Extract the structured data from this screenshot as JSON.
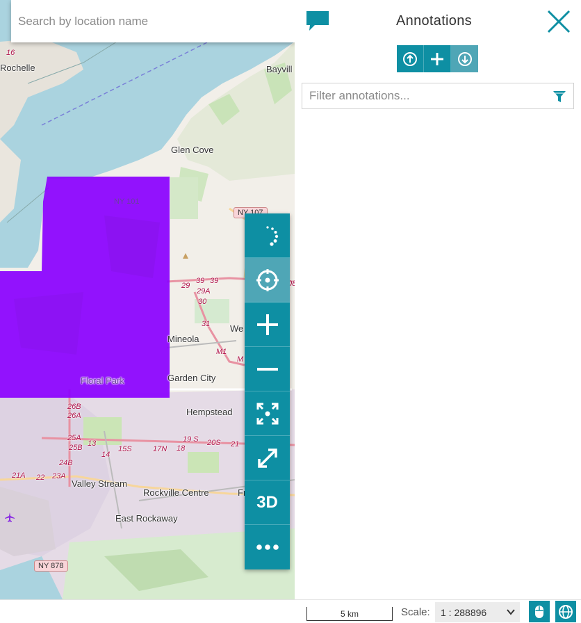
{
  "search": {
    "placeholder": "Search by location name"
  },
  "map": {
    "place_labels": [
      "Rochelle",
      "Bayvill",
      "Glen Cove",
      "Mineola",
      "Garden City",
      "Hempstead",
      "Valley Stream",
      "Rockville Centre",
      "East Rockaway",
      "We",
      "Floral Park",
      "Fr"
    ],
    "road_labels": [
      "16",
      "39",
      "39",
      "29",
      "29A",
      "30",
      "31",
      "M1",
      "M",
      "26B",
      "26A",
      "25A",
      "25B",
      "13",
      "14",
      "15S",
      "17N",
      "18",
      "19 S",
      "20S",
      "21",
      "24B",
      "21A",
      "22",
      "23A",
      "08"
    ],
    "shields": [
      "NY 107",
      "NY 878",
      "NY 101"
    ],
    "overlay_color": "#8a00ff"
  },
  "map_toolbar": {
    "items": [
      {
        "name": "loading-spinner",
        "icon": "spinner-icon"
      },
      {
        "name": "locate-button",
        "icon": "crosshair-icon"
      },
      {
        "name": "zoom-in-button",
        "icon": "plus-icon"
      },
      {
        "name": "zoom-out-button",
        "icon": "minus-icon"
      },
      {
        "name": "zoom-extent-button",
        "icon": "extent-icon"
      },
      {
        "name": "fullscreen-button",
        "icon": "expand-icon"
      },
      {
        "name": "3d-button",
        "label": "3D"
      },
      {
        "name": "more-button",
        "icon": "more-icon"
      }
    ],
    "three_d_label": "3D"
  },
  "annotations": {
    "title": "Annotations",
    "filter_placeholder": "Filter annotations..."
  },
  "bottom_bar": {
    "scale_bar_label": "5 km",
    "scale_label": "Scale:",
    "scale_value": "1 : 288896"
  },
  "colors": {
    "accent": "#0e8fa3",
    "accent_light": "#4fa6b6",
    "water": "#aad3df",
    "overlay": "#8a00ff"
  }
}
